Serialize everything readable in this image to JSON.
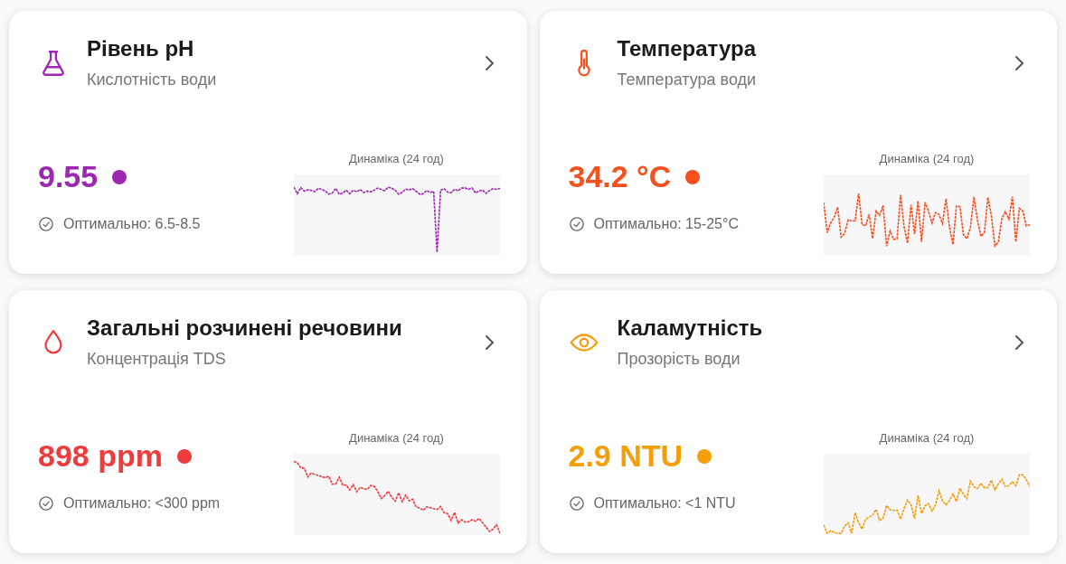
{
  "cards": [
    {
      "title": "Рівень pH",
      "subtitle": "Кислотність води",
      "value": "9.55",
      "color": "#9c27b0",
      "optimal": "Оптимально: 6.5-8.5",
      "chart_label": "Динаміка (24 год)"
    },
    {
      "title": "Температура",
      "subtitle": "Температура води",
      "value": "34.2 °C",
      "color": "#f4511e",
      "optimal": "Оптимально: 15-25°C",
      "chart_label": "Динаміка (24 год)"
    },
    {
      "title": "Загальні розчинені речовини",
      "subtitle": "Концентрація TDS",
      "value": "898 ppm",
      "color": "#ef3b3b",
      "optimal": "Оптимально: <300 ppm",
      "chart_label": "Динаміка (24 год)"
    },
    {
      "title": "Каламутність",
      "subtitle": "Прозорість води",
      "value": "2.9 NTU",
      "color": "#f59e0b",
      "optimal": "Оптимально: <1 NTU",
      "chart_label": "Динаміка (24 год)"
    }
  ]
}
